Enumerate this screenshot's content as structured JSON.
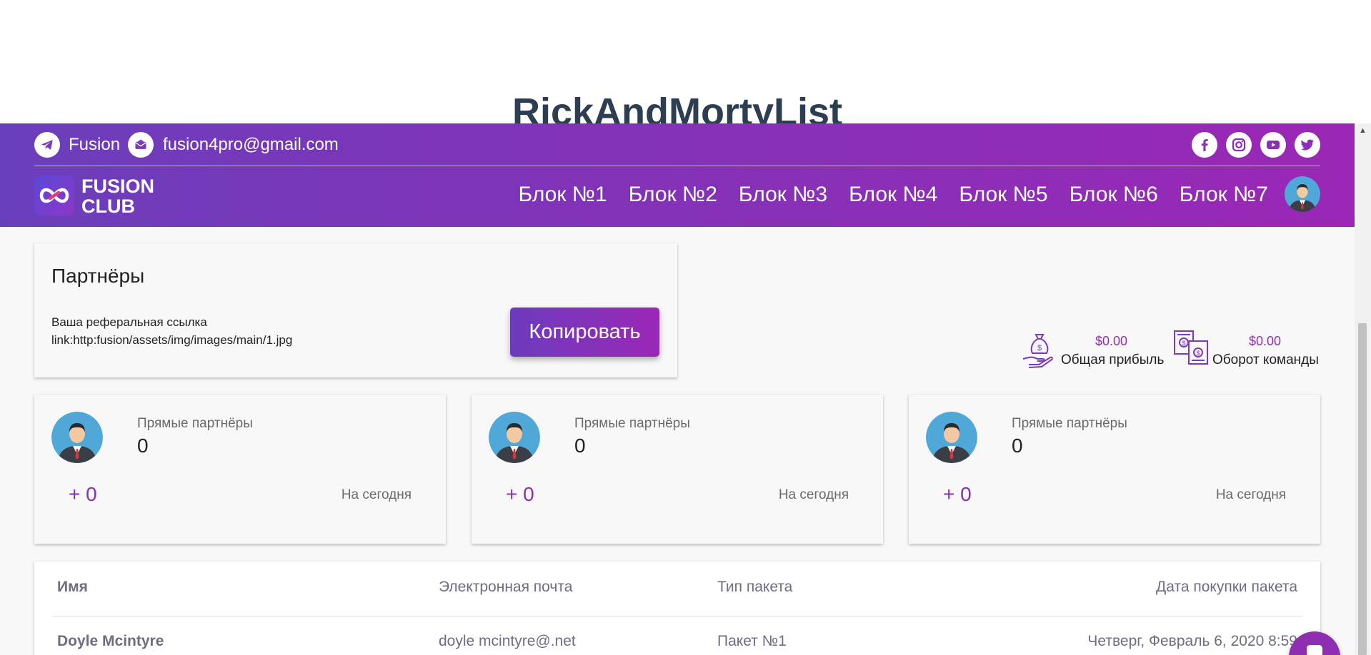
{
  "page": {
    "title": "RickAndMortyList"
  },
  "topbar": {
    "telegram_label": "Fusion",
    "email": "fusion4pro@gmail.com"
  },
  "social_icons": [
    "facebook-icon",
    "instagram-icon",
    "youtube-icon",
    "twitter-icon"
  ],
  "logo": {
    "line1": "FUSION",
    "line2": "CLUB"
  },
  "nav": {
    "items": [
      "Блок №1",
      "Блок №2",
      "Блок №3",
      "Блок №4",
      "Блок №5",
      "Блок №6",
      "Блок №7"
    ]
  },
  "partners": {
    "title": "Партнёры",
    "ref_label": "Ваша реферальная ссылка",
    "ref_link": "link:http:fusion/assets/img/images/main/1.jpg",
    "copy_label": "Копировать"
  },
  "stats": {
    "profit": {
      "value": "$0.00",
      "label": "Общая прибыль"
    },
    "turnover": {
      "value": "$0.00",
      "label": "Оборот команды"
    }
  },
  "partner_cards": [
    {
      "label": "Прямые партнёры",
      "count": "0",
      "delta": "+ 0",
      "period": "На сегодня"
    },
    {
      "label": "Прямые партнёры",
      "count": "0",
      "delta": "+ 0",
      "period": "На сегодня"
    },
    {
      "label": "Прямые партнёры",
      "count": "0",
      "delta": "+ 0",
      "period": "На сегодня"
    }
  ],
  "table": {
    "headers": [
      "Имя",
      "Электронная почта",
      "Тип пакета",
      "Дата покупки пакета"
    ],
    "rows": [
      [
        "Doyle Mcintyre",
        "doyle mcintyre@.net",
        "Пакет №1",
        "Четверг, Февраль 6, 2020 8:59"
      ]
    ]
  },
  "colors": {
    "header_start": "#6a3fbb",
    "header_end": "#9a27b5",
    "accent": "#8e2eb0",
    "background": "#f8f8f8"
  }
}
